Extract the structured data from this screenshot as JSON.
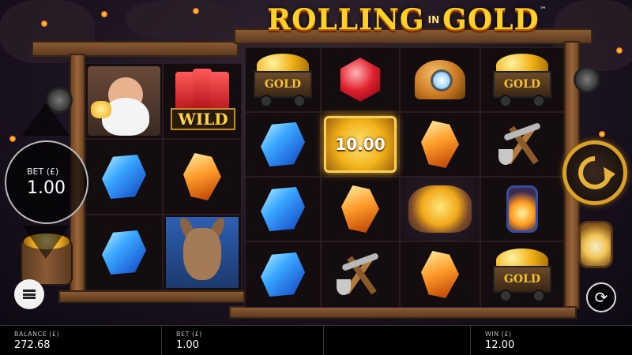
{
  "game": {
    "title_word1": "ROLLING",
    "title_in": "IN",
    "title_word2": "GOLD",
    "trademark": "™"
  },
  "controls": {
    "bet_label": "BET (£)",
    "bet_value": "1.00",
    "menu_icon": "hamburger-menu-icon",
    "spin_icon": "spin-arrow-icon",
    "autoplay_icon": "autoplay-icon"
  },
  "reels": {
    "col1": [
      {
        "symbol": "prospector-portrait"
      },
      {
        "symbol": "blue-gem"
      },
      {
        "symbol": "blue-gem"
      }
    ],
    "col2": [
      {
        "symbol": "dynamite-wild",
        "label": "WILD"
      },
      {
        "symbol": "orange-gem"
      },
      {
        "symbol": "donkey-portrait"
      }
    ],
    "col3": [
      {
        "symbol": "gold-cart",
        "label": "GOLD"
      },
      {
        "symbol": "blue-gem"
      },
      {
        "symbol": "blue-gem"
      },
      {
        "symbol": "blue-gem"
      }
    ],
    "col4": [
      {
        "symbol": "ruby"
      },
      {
        "symbol": "coin-bonus",
        "label": "10.00"
      },
      {
        "symbol": "orange-gem"
      },
      {
        "symbol": "pickaxe-shovel"
      }
    ],
    "col5": [
      {
        "symbol": "miner-helmet"
      },
      {
        "symbol": "orange-gem"
      },
      {
        "symbol": "money-bag"
      },
      {
        "symbol": "orange-gem"
      }
    ],
    "col6": [
      {
        "symbol": "gold-cart",
        "label": "GOLD"
      },
      {
        "symbol": "pickaxe-shovel"
      },
      {
        "symbol": "lantern"
      },
      {
        "symbol": "gold-cart",
        "label": "GOLD"
      }
    ]
  },
  "status_bar": {
    "balance_label": "BALANCE (£)",
    "balance_value": "272.68",
    "bet_label": "BET (£)",
    "bet_value": "1.00",
    "win_label": "WIN (£)",
    "win_value": "12.00"
  },
  "colors": {
    "gold_accent": "#ffcf2a",
    "spin_ring": "#d9a02a",
    "bottom_bar": "#000000"
  }
}
